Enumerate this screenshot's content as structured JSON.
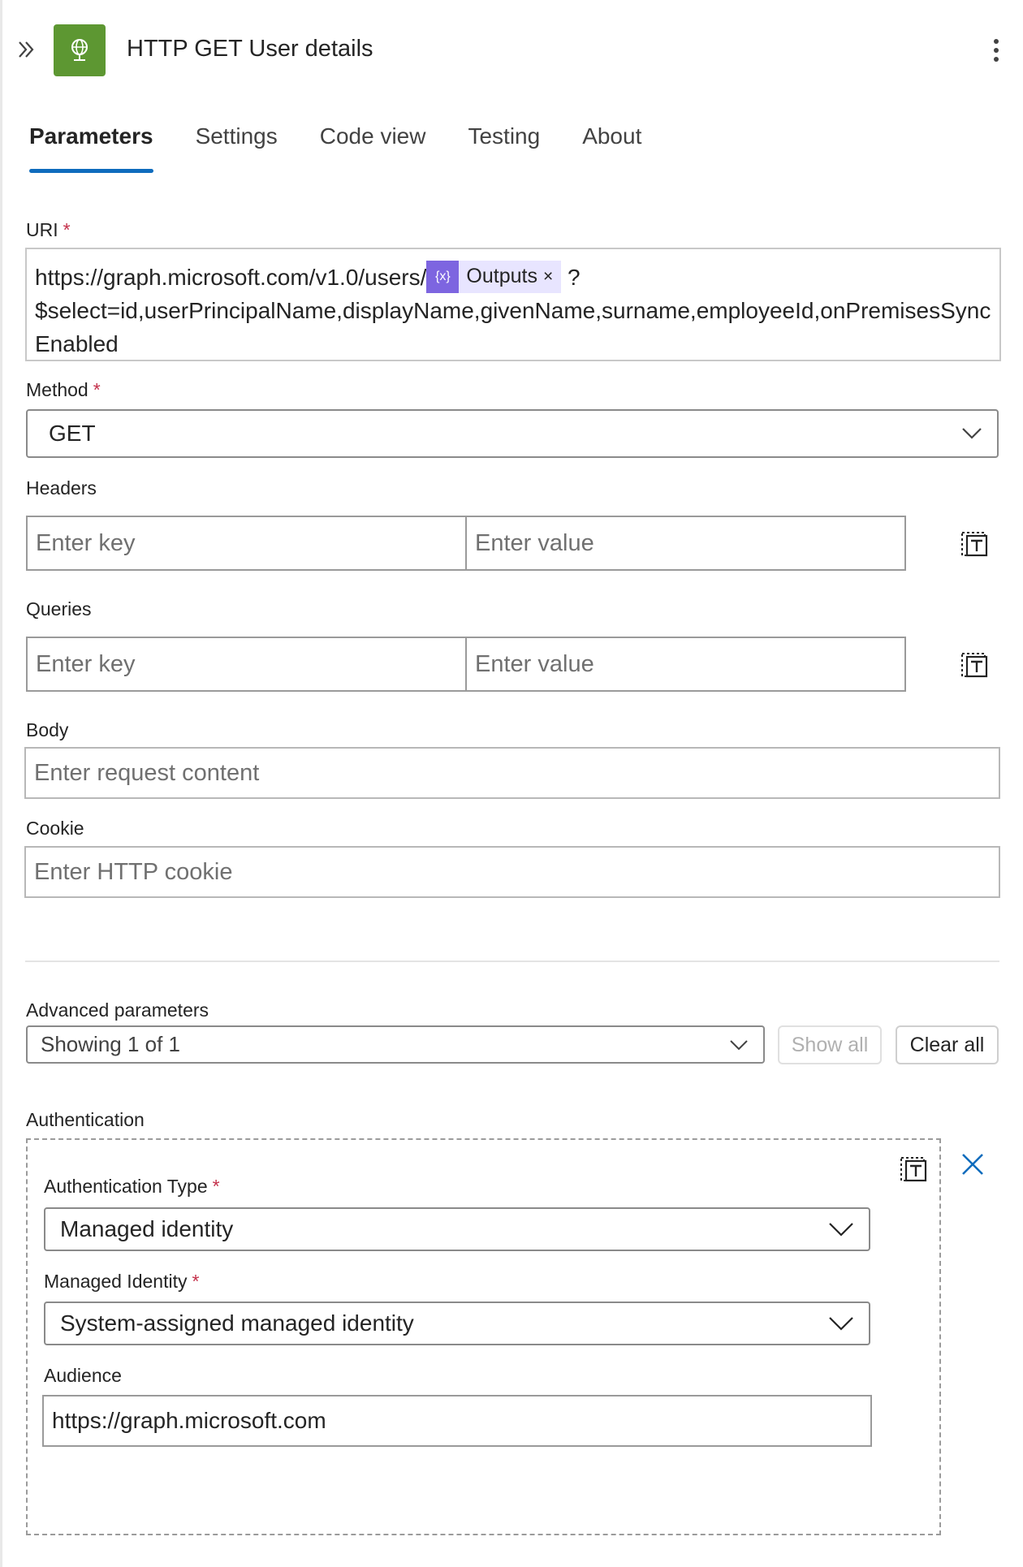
{
  "header": {
    "title": "HTTP GET User details",
    "icon_color": "#5d9732"
  },
  "tabs": [
    {
      "label": "Parameters",
      "active": true
    },
    {
      "label": "Settings",
      "active": false
    },
    {
      "label": "Code view",
      "active": false
    },
    {
      "label": "Testing",
      "active": false
    },
    {
      "label": "About",
      "active": false
    }
  ],
  "uri": {
    "label": "URI",
    "required_mark": "*",
    "prefix": "https://graph.microsoft.com/v1.0/users/",
    "token_label": "Outputs",
    "token_icon": "{x}",
    "token_close": "×",
    "suffix": " ?",
    "query": "$select=id,userPrincipalName,displayName,givenName,surname,employeeId,onPremisesSyncEnabled"
  },
  "method": {
    "label": "Method",
    "required_mark": "*",
    "value": "GET"
  },
  "headers": {
    "label": "Headers",
    "key_placeholder": "Enter key",
    "value_placeholder": "Enter value"
  },
  "queries": {
    "label": "Queries",
    "key_placeholder": "Enter key",
    "value_placeholder": "Enter value"
  },
  "body": {
    "label": "Body",
    "placeholder": "Enter request content"
  },
  "cookie": {
    "label": "Cookie",
    "placeholder": "Enter HTTP cookie"
  },
  "advanced": {
    "label": "Advanced parameters",
    "value": "Showing 1 of 1",
    "show_all": "Show all",
    "clear_all": "Clear all"
  },
  "authentication": {
    "label": "Authentication",
    "type_label": "Authentication Type",
    "type_value": "Managed identity",
    "identity_label": "Managed Identity",
    "identity_value": "System-assigned managed identity",
    "audience_label": "Audience",
    "audience_value": "https://graph.microsoft.com",
    "required_mark": "*"
  },
  "colors": {
    "accent": "#0f6cbd",
    "token": "#7d65e0",
    "required": "#c4314b"
  }
}
